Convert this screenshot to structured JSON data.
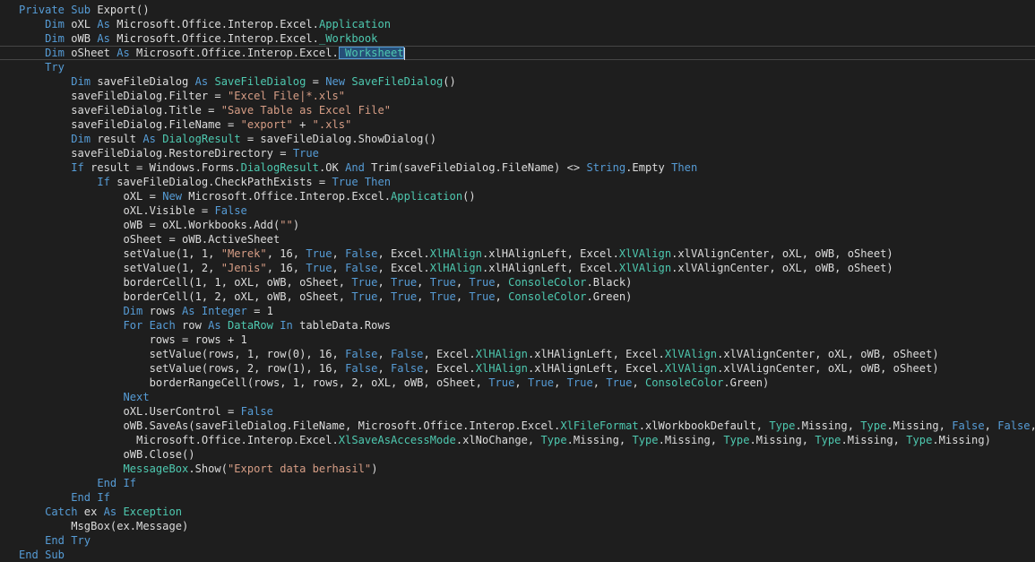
{
  "editor": {
    "language": "vb",
    "current_line": 3,
    "colors": {
      "background": "#1e1e1e",
      "plain": "#dcdcdc",
      "keyword": "#569cd6",
      "type": "#4ec9b0",
      "string": "#d69d85",
      "selection": "#264f78"
    },
    "lines": [
      {
        "indent": 0,
        "tokens": [
          [
            "kw",
            "Private Sub"
          ],
          [
            "pl",
            " Export()"
          ]
        ]
      },
      {
        "indent": 1,
        "tokens": [
          [
            "kw",
            "Dim"
          ],
          [
            "pl",
            " oXL "
          ],
          [
            "kw",
            "As"
          ],
          [
            "pl",
            " Microsoft.Office.Interop.Excel."
          ],
          [
            "ty",
            "Application"
          ]
        ]
      },
      {
        "indent": 1,
        "tokens": [
          [
            "kw",
            "Dim"
          ],
          [
            "pl",
            " oWB "
          ],
          [
            "kw",
            "As"
          ],
          [
            "pl",
            " Microsoft.Office.Interop.Excel."
          ],
          [
            "ty",
            "_Workbook"
          ]
        ]
      },
      {
        "indent": 1,
        "tokens": [
          [
            "kw",
            "Dim"
          ],
          [
            "pl",
            " oSheet "
          ],
          [
            "kw",
            "As"
          ],
          [
            "pl",
            " Microsoft.Office.Interop.Excel."
          ],
          [
            "sel",
            "_Worksheet"
          ]
        ]
      },
      {
        "indent": 1,
        "tokens": [
          [
            "kw",
            "Try"
          ]
        ]
      },
      {
        "indent": 2,
        "tokens": [
          [
            "kw",
            "Dim"
          ],
          [
            "pl",
            " saveFileDialog "
          ],
          [
            "kw",
            "As"
          ],
          [
            "pl",
            " "
          ],
          [
            "ty",
            "SaveFileDialog"
          ],
          [
            "pl",
            " = "
          ],
          [
            "kw",
            "New"
          ],
          [
            "pl",
            " "
          ],
          [
            "ty",
            "SaveFileDialog"
          ],
          [
            "pl",
            "()"
          ]
        ]
      },
      {
        "indent": 2,
        "tokens": [
          [
            "pl",
            "saveFileDialog.Filter = "
          ],
          [
            "str",
            "\"Excel File|*.xls\""
          ]
        ]
      },
      {
        "indent": 2,
        "tokens": [
          [
            "pl",
            "saveFileDialog.Title = "
          ],
          [
            "str",
            "\"Save Table as Excel File\""
          ]
        ]
      },
      {
        "indent": 2,
        "tokens": [
          [
            "pl",
            "saveFileDialog.FileName = "
          ],
          [
            "str",
            "\"export\""
          ],
          [
            "pl",
            " + "
          ],
          [
            "str",
            "\".xls\""
          ]
        ]
      },
      {
        "indent": 2,
        "tokens": [
          [
            "kw",
            "Dim"
          ],
          [
            "pl",
            " result "
          ],
          [
            "kw",
            "As"
          ],
          [
            "pl",
            " "
          ],
          [
            "ty",
            "DialogResult"
          ],
          [
            "pl",
            " = saveFileDialog.ShowDialog()"
          ]
        ]
      },
      {
        "indent": 2,
        "tokens": [
          [
            "pl",
            "saveFileDialog.RestoreDirectory = "
          ],
          [
            "kw",
            "True"
          ]
        ]
      },
      {
        "indent": 2,
        "tokens": [
          [
            "kw",
            "If"
          ],
          [
            "pl",
            " result = Windows.Forms."
          ],
          [
            "ty",
            "DialogResult"
          ],
          [
            "pl",
            ".OK "
          ],
          [
            "kw",
            "And"
          ],
          [
            "pl",
            " Trim(saveFileDialog.FileName) <> "
          ],
          [
            "kw",
            "String"
          ],
          [
            "pl",
            ".Empty "
          ],
          [
            "kw",
            "Then"
          ]
        ]
      },
      {
        "indent": 3,
        "tokens": [
          [
            "kw",
            "If"
          ],
          [
            "pl",
            " saveFileDialog.CheckPathExists = "
          ],
          [
            "kw",
            "True"
          ],
          [
            "pl",
            " "
          ],
          [
            "kw",
            "Then"
          ]
        ]
      },
      {
        "indent": 4,
        "tokens": [
          [
            "pl",
            "oXL = "
          ],
          [
            "kw",
            "New"
          ],
          [
            "pl",
            " Microsoft.Office.Interop.Excel."
          ],
          [
            "ty",
            "Application"
          ],
          [
            "pl",
            "()"
          ]
        ]
      },
      {
        "indent": 4,
        "tokens": [
          [
            "pl",
            "oXL.Visible = "
          ],
          [
            "kw",
            "False"
          ]
        ]
      },
      {
        "indent": 4,
        "tokens": [
          [
            "pl",
            "oWB = oXL.Workbooks.Add("
          ],
          [
            "str",
            "\"\""
          ],
          [
            "pl",
            ")"
          ]
        ]
      },
      {
        "indent": 4,
        "tokens": [
          [
            "pl",
            "oSheet = oWB.ActiveSheet"
          ]
        ]
      },
      {
        "indent": 4,
        "tokens": [
          [
            "pl",
            "setValue(1, 1, "
          ],
          [
            "str",
            "\"Merek\""
          ],
          [
            "pl",
            ", 16, "
          ],
          [
            "kw",
            "True"
          ],
          [
            "pl",
            ", "
          ],
          [
            "kw",
            "False"
          ],
          [
            "pl",
            ", Excel."
          ],
          [
            "ty",
            "XlHAlign"
          ],
          [
            "pl",
            ".xlHAlignLeft, Excel."
          ],
          [
            "ty",
            "XlVAlign"
          ],
          [
            "pl",
            ".xlVAlignCenter, oXL, oWB, oSheet)"
          ]
        ]
      },
      {
        "indent": 4,
        "tokens": [
          [
            "pl",
            "setValue(1, 2, "
          ],
          [
            "str",
            "\"Jenis\""
          ],
          [
            "pl",
            ", 16, "
          ],
          [
            "kw",
            "True"
          ],
          [
            "pl",
            ", "
          ],
          [
            "kw",
            "False"
          ],
          [
            "pl",
            ", Excel."
          ],
          [
            "ty",
            "XlHAlign"
          ],
          [
            "pl",
            ".xlHAlignLeft, Excel."
          ],
          [
            "ty",
            "XlVAlign"
          ],
          [
            "pl",
            ".xlVAlignCenter, oXL, oWB, oSheet)"
          ]
        ]
      },
      {
        "indent": 4,
        "tokens": [
          [
            "pl",
            "borderCell(1, 1, oXL, oWB, oSheet, "
          ],
          [
            "kw",
            "True"
          ],
          [
            "pl",
            ", "
          ],
          [
            "kw",
            "True"
          ],
          [
            "pl",
            ", "
          ],
          [
            "kw",
            "True"
          ],
          [
            "pl",
            ", "
          ],
          [
            "kw",
            "True"
          ],
          [
            "pl",
            ", "
          ],
          [
            "ty",
            "ConsoleColor"
          ],
          [
            "pl",
            ".Black)"
          ]
        ]
      },
      {
        "indent": 4,
        "tokens": [
          [
            "pl",
            "borderCell(1, 2, oXL, oWB, oSheet, "
          ],
          [
            "kw",
            "True"
          ],
          [
            "pl",
            ", "
          ],
          [
            "kw",
            "True"
          ],
          [
            "pl",
            ", "
          ],
          [
            "kw",
            "True"
          ],
          [
            "pl",
            ", "
          ],
          [
            "kw",
            "True"
          ],
          [
            "pl",
            ", "
          ],
          [
            "ty",
            "ConsoleColor"
          ],
          [
            "pl",
            ".Green)"
          ]
        ]
      },
      {
        "indent": 4,
        "tokens": [
          [
            "kw",
            "Dim"
          ],
          [
            "pl",
            " rows "
          ],
          [
            "kw",
            "As"
          ],
          [
            "pl",
            " "
          ],
          [
            "kw",
            "Integer"
          ],
          [
            "pl",
            " = 1"
          ]
        ]
      },
      {
        "indent": 4,
        "tokens": [
          [
            "kw",
            "For Each"
          ],
          [
            "pl",
            " row "
          ],
          [
            "kw",
            "As"
          ],
          [
            "pl",
            " "
          ],
          [
            "ty",
            "DataRow"
          ],
          [
            "pl",
            " "
          ],
          [
            "kw",
            "In"
          ],
          [
            "pl",
            " tableData.Rows"
          ]
        ]
      },
      {
        "indent": 5,
        "tokens": [
          [
            "pl",
            "rows = rows + 1"
          ]
        ]
      },
      {
        "indent": 5,
        "tokens": [
          [
            "pl",
            "setValue(rows, 1, row(0), 16, "
          ],
          [
            "kw",
            "False"
          ],
          [
            "pl",
            ", "
          ],
          [
            "kw",
            "False"
          ],
          [
            "pl",
            ", Excel."
          ],
          [
            "ty",
            "XlHAlign"
          ],
          [
            "pl",
            ".xlHAlignLeft, Excel."
          ],
          [
            "ty",
            "XlVAlign"
          ],
          [
            "pl",
            ".xlVAlignCenter, oXL, oWB, oSheet)"
          ]
        ]
      },
      {
        "indent": 5,
        "tokens": [
          [
            "pl",
            "setValue(rows, 2, row(1), 16, "
          ],
          [
            "kw",
            "False"
          ],
          [
            "pl",
            ", "
          ],
          [
            "kw",
            "False"
          ],
          [
            "pl",
            ", Excel."
          ],
          [
            "ty",
            "XlHAlign"
          ],
          [
            "pl",
            ".xlHAlignLeft, Excel."
          ],
          [
            "ty",
            "XlVAlign"
          ],
          [
            "pl",
            ".xlVAlignCenter, oXL, oWB, oSheet)"
          ]
        ]
      },
      {
        "indent": 5,
        "tokens": [
          [
            "pl",
            "borderRangeCell(rows, 1, rows, 2, oXL, oWB, oSheet, "
          ],
          [
            "kw",
            "True"
          ],
          [
            "pl",
            ", "
          ],
          [
            "kw",
            "True"
          ],
          [
            "pl",
            ", "
          ],
          [
            "kw",
            "True"
          ],
          [
            "pl",
            ", "
          ],
          [
            "kw",
            "True"
          ],
          [
            "pl",
            ", "
          ],
          [
            "ty",
            "ConsoleColor"
          ],
          [
            "pl",
            ".Green)"
          ]
        ]
      },
      {
        "indent": 4,
        "tokens": [
          [
            "kw",
            "Next"
          ]
        ]
      },
      {
        "indent": 4,
        "tokens": [
          [
            "pl",
            "oXL.UserControl = "
          ],
          [
            "kw",
            "False"
          ]
        ]
      },
      {
        "indent": 4,
        "tokens": [
          [
            "pl",
            "oWB.SaveAs(saveFileDialog.FileName, Microsoft.Office.Interop.Excel."
          ],
          [
            "ty",
            "XlFileFormat"
          ],
          [
            "pl",
            ".xlWorkbookDefault, "
          ],
          [
            "ty",
            "Type"
          ],
          [
            "pl",
            ".Missing, "
          ],
          [
            "ty",
            "Type"
          ],
          [
            "pl",
            ".Missing, "
          ],
          [
            "kw",
            "False"
          ],
          [
            "pl",
            ", "
          ],
          [
            "kw",
            "False"
          ],
          [
            "pl",
            ","
          ]
        ]
      },
      {
        "indent": 4,
        "extra": "  ",
        "tokens": [
          [
            "pl",
            "Microsoft.Office.Interop.Excel."
          ],
          [
            "ty",
            "XlSaveAsAccessMode"
          ],
          [
            "pl",
            ".xlNoChange, "
          ],
          [
            "ty",
            "Type"
          ],
          [
            "pl",
            ".Missing, "
          ],
          [
            "ty",
            "Type"
          ],
          [
            "pl",
            ".Missing, "
          ],
          [
            "ty",
            "Type"
          ],
          [
            "pl",
            ".Missing, "
          ],
          [
            "ty",
            "Type"
          ],
          [
            "pl",
            ".Missing, "
          ],
          [
            "ty",
            "Type"
          ],
          [
            "pl",
            ".Missing)"
          ]
        ]
      },
      {
        "indent": 4,
        "tokens": [
          [
            "pl",
            "oWB.Close()"
          ]
        ]
      },
      {
        "indent": 4,
        "tokens": [
          [
            "ty",
            "MessageBox"
          ],
          [
            "pl",
            ".Show("
          ],
          [
            "str",
            "\"Export data berhasil\""
          ],
          [
            "pl",
            ")"
          ]
        ]
      },
      {
        "indent": 3,
        "tokens": [
          [
            "kw",
            "End If"
          ]
        ]
      },
      {
        "indent": 2,
        "tokens": [
          [
            "kw",
            "End If"
          ]
        ]
      },
      {
        "indent": 1,
        "tokens": [
          [
            "kw",
            "Catch"
          ],
          [
            "pl",
            " ex "
          ],
          [
            "kw",
            "As"
          ],
          [
            "pl",
            " "
          ],
          [
            "ty",
            "Exception"
          ]
        ]
      },
      {
        "indent": 2,
        "tokens": [
          [
            "pl",
            "MsgBox(ex.Message)"
          ]
        ]
      },
      {
        "indent": 1,
        "tokens": [
          [
            "kw",
            "End Try"
          ]
        ]
      },
      {
        "indent": 0,
        "tokens": [
          [
            "kw",
            "End Sub"
          ]
        ]
      }
    ]
  }
}
